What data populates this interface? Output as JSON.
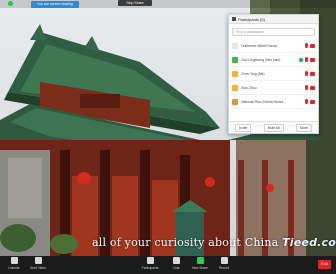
{
  "share_bar": {
    "title": "You are screen sharing",
    "stop_label": "Stop Share"
  },
  "caption": {
    "text": "all of your curiosity about China",
    "brand": "Tieed.com"
  },
  "participants_panel": {
    "title": "Participants (5)",
    "search_placeholder": "Find a participant",
    "participants": [
      {
        "name": "Guilherme Mirelli Sousa",
        "avatar_color": "#e3e3e3",
        "sharing": false
      },
      {
        "name": "Guo Lingsheng (Wei Lian)",
        "avatar_color": "#4caf50",
        "sharing": true
      },
      {
        "name": "Chen Ying (Me)",
        "avatar_color": "#f2b233",
        "sharing": false
      },
      {
        "name": "Xiao Zhou",
        "avatar_color": "#f2b233",
        "sharing": false
      },
      {
        "name": "Halenda Ricci Kebria Rucka",
        "avatar_color": "#d79443",
        "sharing": false
      }
    ],
    "footer_buttons": [
      "Invite",
      "Mute All",
      "More"
    ]
  },
  "toolbar": {
    "items": [
      {
        "label": "Unmute",
        "icon": "mic-icon",
        "green": false
      },
      {
        "label": "Start Video",
        "icon": "video-icon",
        "green": false
      },
      {
        "label": "Participants",
        "icon": "participants-icon",
        "green": false
      },
      {
        "label": "Chat",
        "icon": "chat-icon",
        "green": false
      },
      {
        "label": "New Share",
        "icon": "share-screen-icon",
        "green": true
      },
      {
        "label": "Record",
        "icon": "record-icon",
        "green": false
      }
    ],
    "end_label": "End"
  },
  "colors": {
    "accent_blue": "#2f8bd8",
    "danger_red": "#e02424",
    "share_green": "#34c759"
  }
}
